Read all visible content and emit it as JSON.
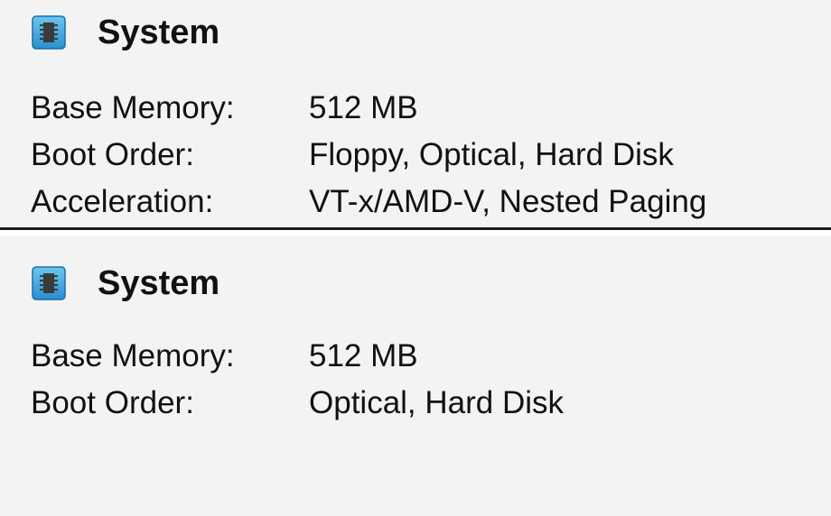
{
  "colors": {
    "panel_bg": "#f3f3f3",
    "divider": "#1c1c1c",
    "icon_blue": "#3aa2dc",
    "icon_chip": "#3b3b3b"
  },
  "icons": {
    "section_icon": "chip-icon"
  },
  "panels": [
    {
      "title": "System",
      "rows": [
        {
          "label": "Base Memory:",
          "value": "512 MB"
        },
        {
          "label": "Boot Order:",
          "value": "Floppy, Optical, Hard Disk"
        },
        {
          "label": "Acceleration:",
          "value": "VT-x/AMD-V, Nested Paging"
        }
      ]
    },
    {
      "title": "System",
      "rows": [
        {
          "label": "Base Memory:",
          "value": "512 MB"
        },
        {
          "label": "Boot Order:",
          "value": "Optical, Hard Disk"
        }
      ]
    }
  ]
}
